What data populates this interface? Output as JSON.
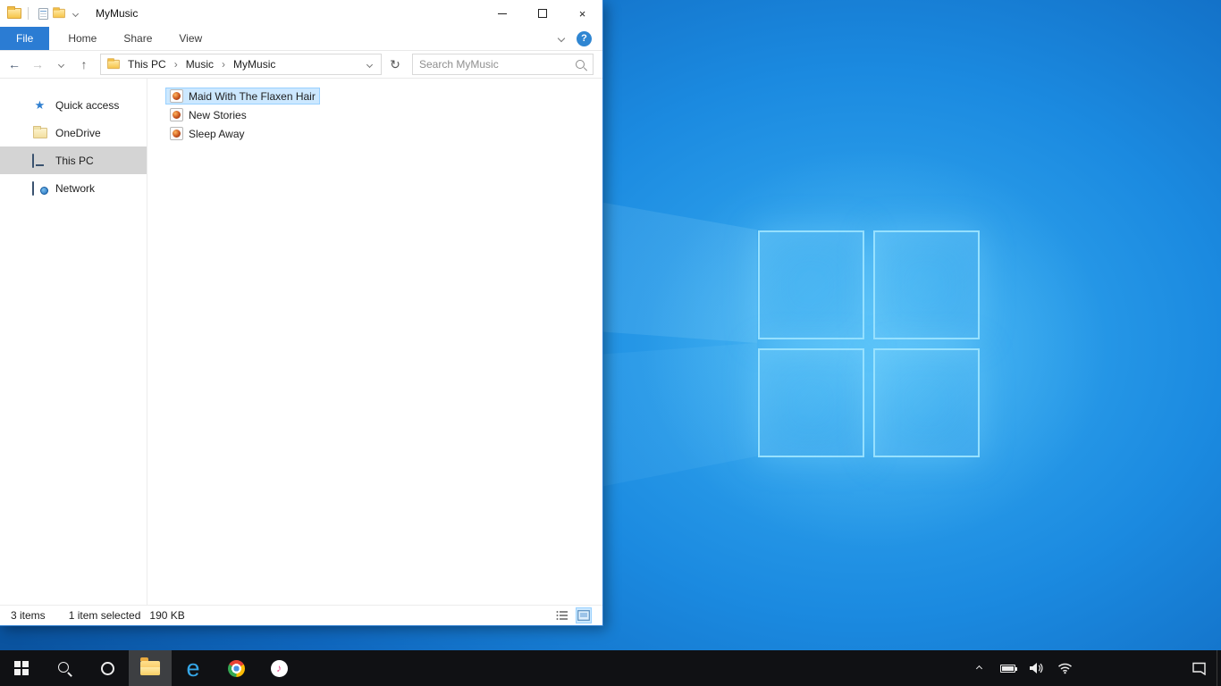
{
  "colors": {
    "accent_blue": "#2b7cd3",
    "selection_fill": "#cce8ff",
    "selection_border": "#99d1ff",
    "sidebar_selected": "#d4d4d4",
    "taskbar": "#101114",
    "wallpaper_deep": "#0a539f",
    "wallpaper_bright": "#38aef2"
  },
  "glyphs": {
    "back": "←",
    "forward": "→",
    "up": "↑",
    "refresh": "↻",
    "crumb_sep": "›",
    "help": "?",
    "close": "×",
    "star": "★",
    "note": "♪",
    "edge_e": "e"
  },
  "explorer": {
    "title": "MyMusic",
    "ribbon_tabs": {
      "file": "File",
      "home": "Home",
      "share": "Share",
      "view": "View"
    },
    "breadcrumb": {
      "items": [
        "This PC",
        "Music",
        "MyMusic"
      ]
    },
    "search": {
      "placeholder": "Search MyMusic"
    },
    "sidebar": [
      {
        "label": "Quick access"
      },
      {
        "label": "OneDrive"
      },
      {
        "label": "This PC",
        "selected": true
      },
      {
        "label": "Network"
      }
    ],
    "files": [
      {
        "name": "Maid With The Flaxen Hair",
        "selected": true
      },
      {
        "name": "New Stories"
      },
      {
        "name": "Sleep Away"
      }
    ],
    "status": {
      "count": "3 items",
      "selected": "1 item selected",
      "size": "190 KB"
    }
  },
  "taskbar": {
    "apps": [
      "start",
      "search",
      "cortana",
      "file-explorer",
      "internet-explorer",
      "chrome",
      "itunes"
    ],
    "active_app": "file-explorer",
    "tray": [
      "hidden-icons",
      "battery",
      "volume",
      "network",
      "action-center"
    ]
  }
}
